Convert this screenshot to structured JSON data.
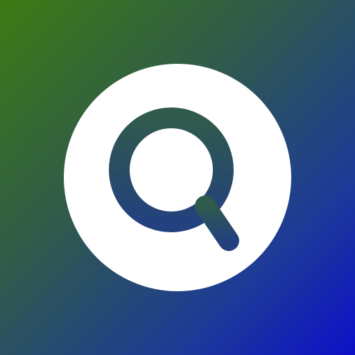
{
  "icon": {
    "name": "search-icon",
    "background_gradient": [
      "#3d7a12",
      "#2f5a4c",
      "#1d3a98",
      "#0d10c8"
    ],
    "circle_color": "#ffffff",
    "glyph_gradient": [
      "#2f5a4c",
      "#23417e"
    ]
  }
}
